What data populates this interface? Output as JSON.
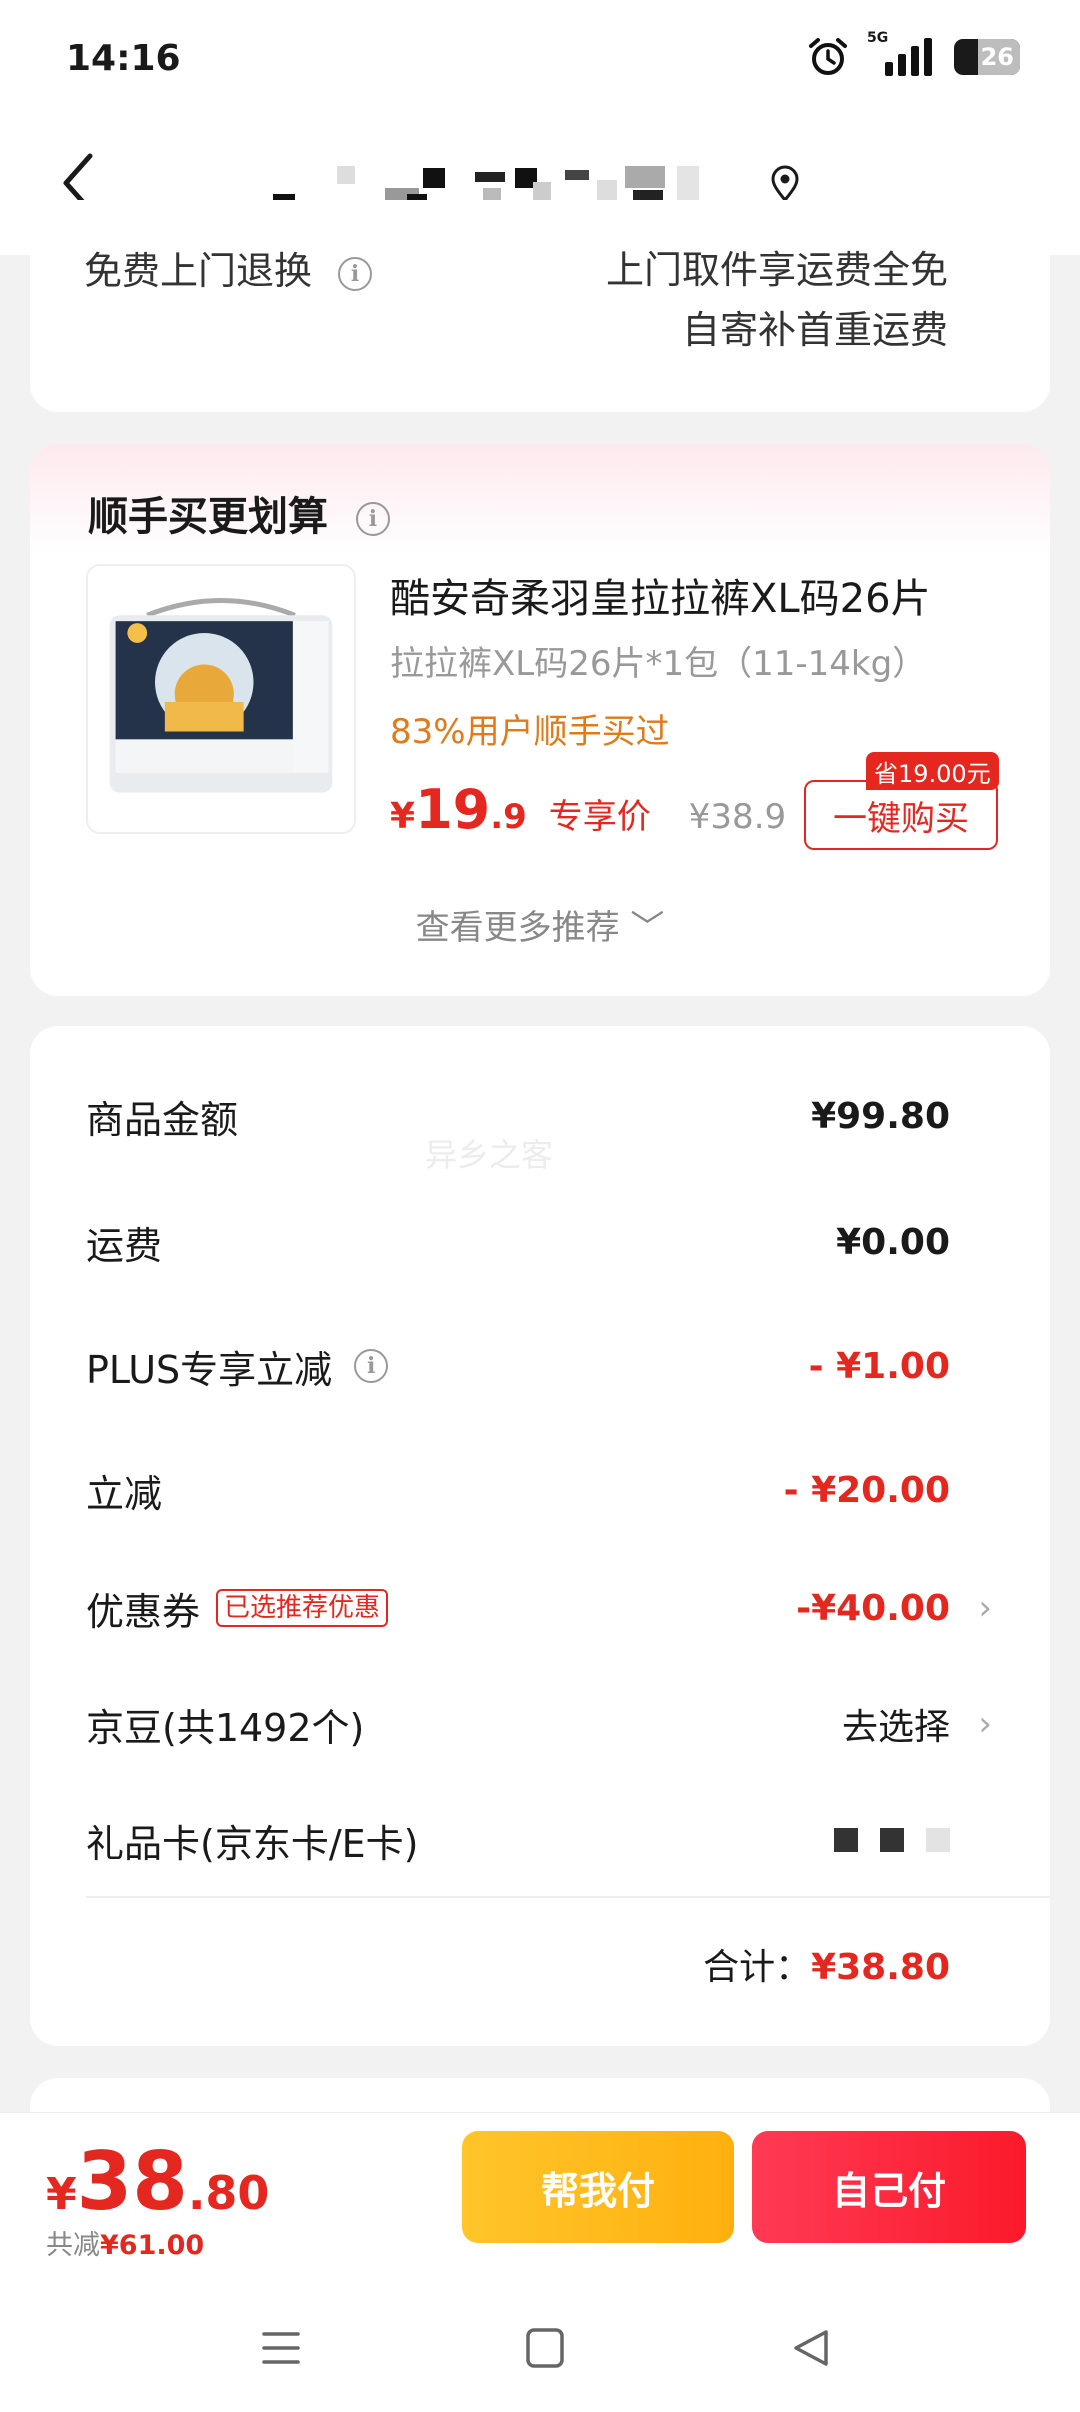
{
  "status_bar": {
    "time": "14:16",
    "network": "5G",
    "battery": "26"
  },
  "return_info": {
    "left": "免费上门退换",
    "right_line1": "上门取件享运费全免",
    "right_line2": "自寄补首重运费"
  },
  "recommend": {
    "title": "顺手买更划算",
    "product": {
      "name": "酷安奇柔羽皇拉拉裤XL码26片",
      "spec": "拉拉裤XL码26片*1包（11-14kg）",
      "bought": "83%用户顺手买过",
      "price_currency": "¥",
      "price_int": "19",
      "price_dec": ".9",
      "price_tag": "专享价",
      "original_price": "¥38.9",
      "save_badge": "省19.00元",
      "buy_button": "一键购买"
    },
    "more": "查看更多推荐"
  },
  "amounts": {
    "watermark": "异乡之客",
    "rows": [
      {
        "label": "商品金额",
        "value": "¥99.80"
      },
      {
        "label": "运费",
        "value": "¥0.00"
      },
      {
        "label": "PLUS专享立减",
        "value": "- ¥1.00"
      },
      {
        "label": "立减",
        "value": "- ¥20.00"
      },
      {
        "label": "优惠券",
        "tag": "已选推荐优惠",
        "value": "-¥40.00"
      },
      {
        "label": "京豆(共1492个)",
        "value": "去选择"
      },
      {
        "label": "礼品卡(京东卡/E卡)",
        "value": ""
      }
    ],
    "total_label": "合计：",
    "total_value": "¥38.80"
  },
  "bottom": {
    "currency": "¥",
    "total_int": "38",
    "total_dec": ".80",
    "saved_label": "共减",
    "saved_value": "¥61.00",
    "help_pay": "帮我付",
    "self_pay": "自己付"
  },
  "colors": {
    "accent": "#e5281f",
    "help_button": "#ffb81a",
    "self_button": "#fb1a2a",
    "bought_text": "#e07a1a"
  }
}
